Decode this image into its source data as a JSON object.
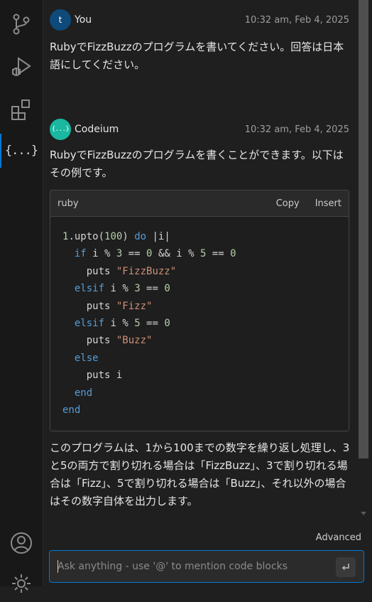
{
  "activity_bar": {
    "icons": [
      "source-control-icon",
      "run-debug-icon",
      "extensions-icon",
      "codeium-chat-icon",
      "account-icon",
      "settings-icon"
    ],
    "chat_icon_glyph": "{...}"
  },
  "conversation": {
    "user_message": {
      "avatar_letter": "t",
      "name": "You",
      "timestamp": "10:32 am, Feb 4, 2025",
      "text": "RubyでFizzBuzzのプログラムを書いてください。回答は日本語にしてください。"
    },
    "bot_message": {
      "avatar_glyph": "{...}",
      "name": "Codeium",
      "timestamp": "10:32 am, Feb 4, 2025",
      "intro": "RubyでFizzBuzzのプログラムを書くことができます。以下はその例です。",
      "code_block": {
        "language": "ruby",
        "copy_label": "Copy",
        "insert_label": "Insert",
        "lines": [
          "1.upto(100) do |i|",
          "  if i % 3 == 0 && i % 5 == 0",
          "    puts \"FizzBuzz\"",
          "  elsif i % 3 == 0",
          "    puts \"Fizz\"",
          "  elsif i % 5 == 0",
          "    puts \"Buzz\"",
          "  else",
          "    puts i",
          "  end",
          "end"
        ]
      },
      "explanation": "このプログラムは、1から100までの数字を繰り返し処理し、3と5の両方で割り切れる場合は「FizzBuzz」、3で割り切れる場合は「Fizz」、5で割り切れる場合は「Buzz」、それ以外の場合はその数字自体を出力します。"
    }
  },
  "footer": {
    "advanced_label": "Advanced",
    "input_placeholder": "Ask anything - use '@' to mention code blocks",
    "input_value": ""
  },
  "colors": {
    "accent": "#0078d4",
    "keyword": "#569cd6",
    "number": "#b5cea8",
    "string": "#ce9178",
    "user_avatar": "#0e4a7a",
    "bot_avatar": "#1ab8a0"
  }
}
